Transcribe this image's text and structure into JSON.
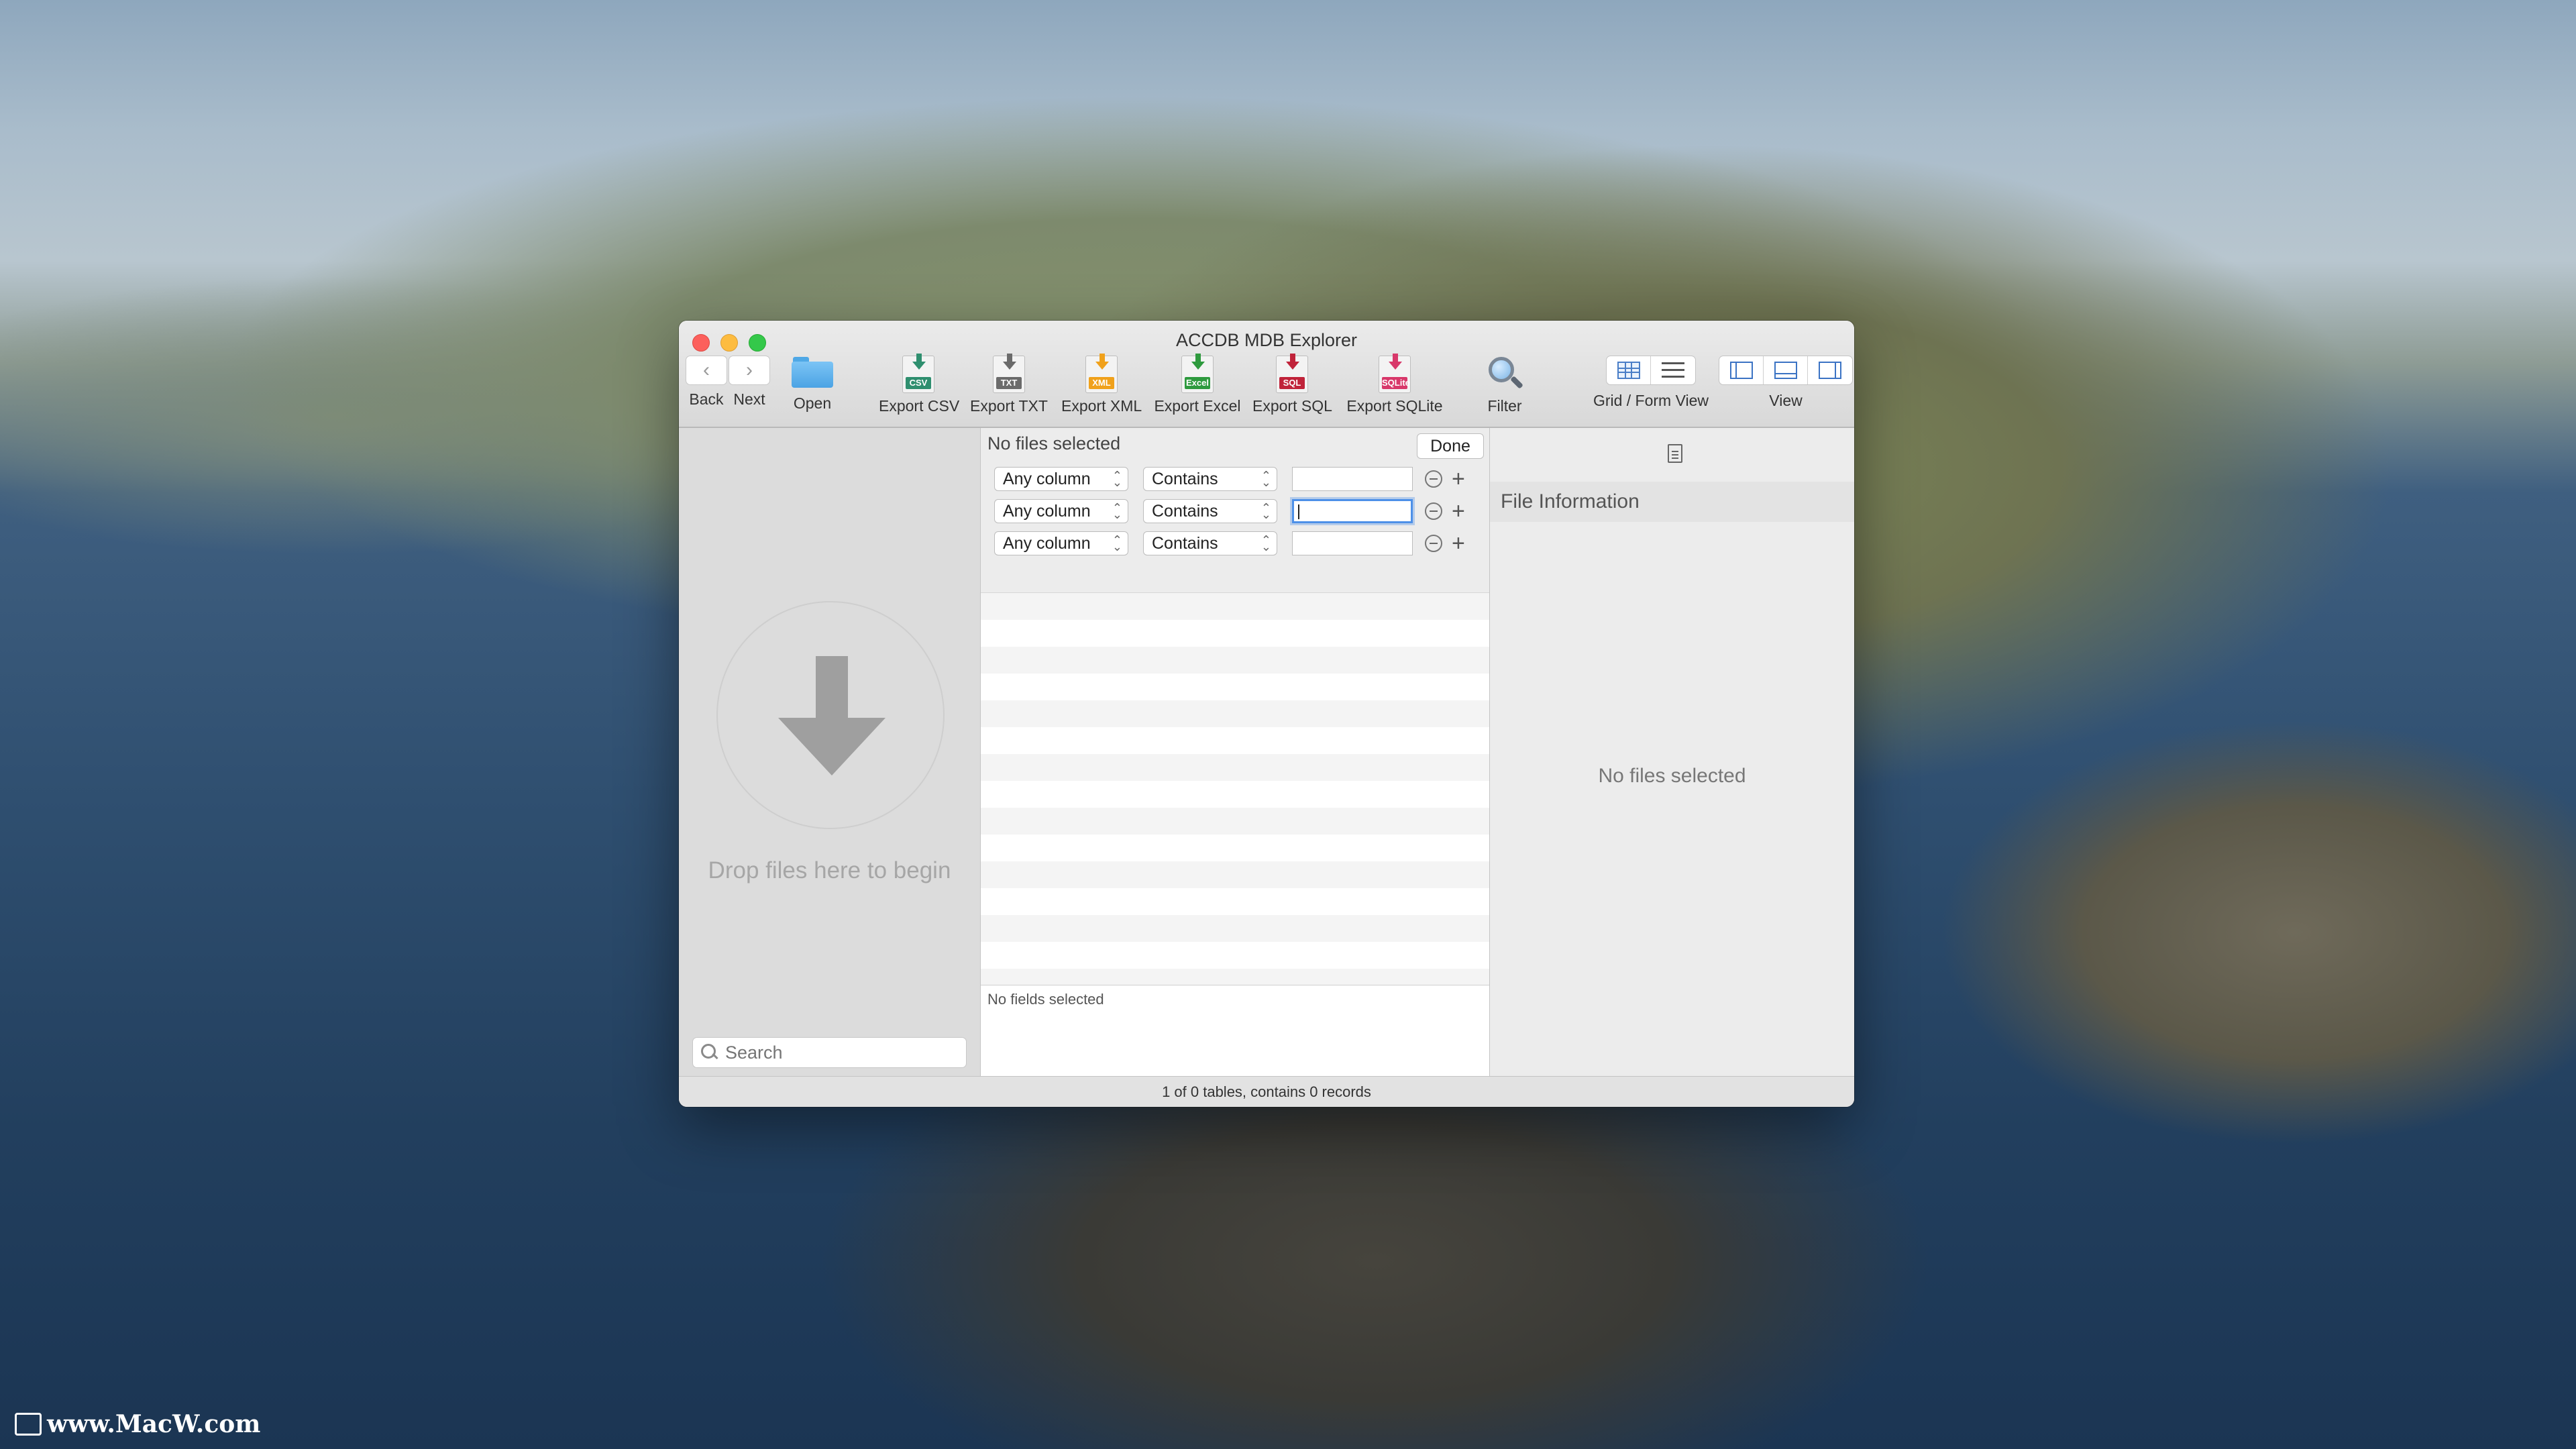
{
  "window": {
    "title": "ACCDB MDB Explorer"
  },
  "toolbar": {
    "back": "Back",
    "next": "Next",
    "open": "Open",
    "export_csv": {
      "label": "Export CSV",
      "tag": "CSV",
      "color": "#2f8f6f"
    },
    "export_txt": {
      "label": "Export TXT",
      "tag": "TXT",
      "color": "#6b6b6b"
    },
    "export_xml": {
      "label": "Export XML",
      "tag": "XML",
      "color": "#f0a11b"
    },
    "export_excel": {
      "label": "Export Excel",
      "tag": "Excel",
      "color": "#2e9a3e"
    },
    "export_sql": {
      "label": "Export SQL",
      "tag": "SQL",
      "color": "#c0233a"
    },
    "export_sqlite": {
      "label": "Export SQLite",
      "tag": "SQLite",
      "color": "#d8386a"
    },
    "filter": "Filter",
    "grid_form_view": "Grid / Form View",
    "view": "View"
  },
  "sidebar": {
    "drop_text": "Drop files here to begin",
    "search_placeholder": "Search"
  },
  "filter": {
    "header": "No files selected",
    "done": "Done",
    "rows": [
      {
        "column": "Any column",
        "operator": "Contains",
        "value": ""
      },
      {
        "column": "Any column",
        "operator": "Contains",
        "value": ""
      },
      {
        "column": "Any column",
        "operator": "Contains",
        "value": ""
      }
    ]
  },
  "fields": {
    "label": "No fields selected"
  },
  "info": {
    "header": "File Information",
    "empty": "No files selected"
  },
  "status": {
    "text": "1 of 0 tables, contains 0 records"
  },
  "watermark": {
    "text": "www.MacW.com"
  }
}
